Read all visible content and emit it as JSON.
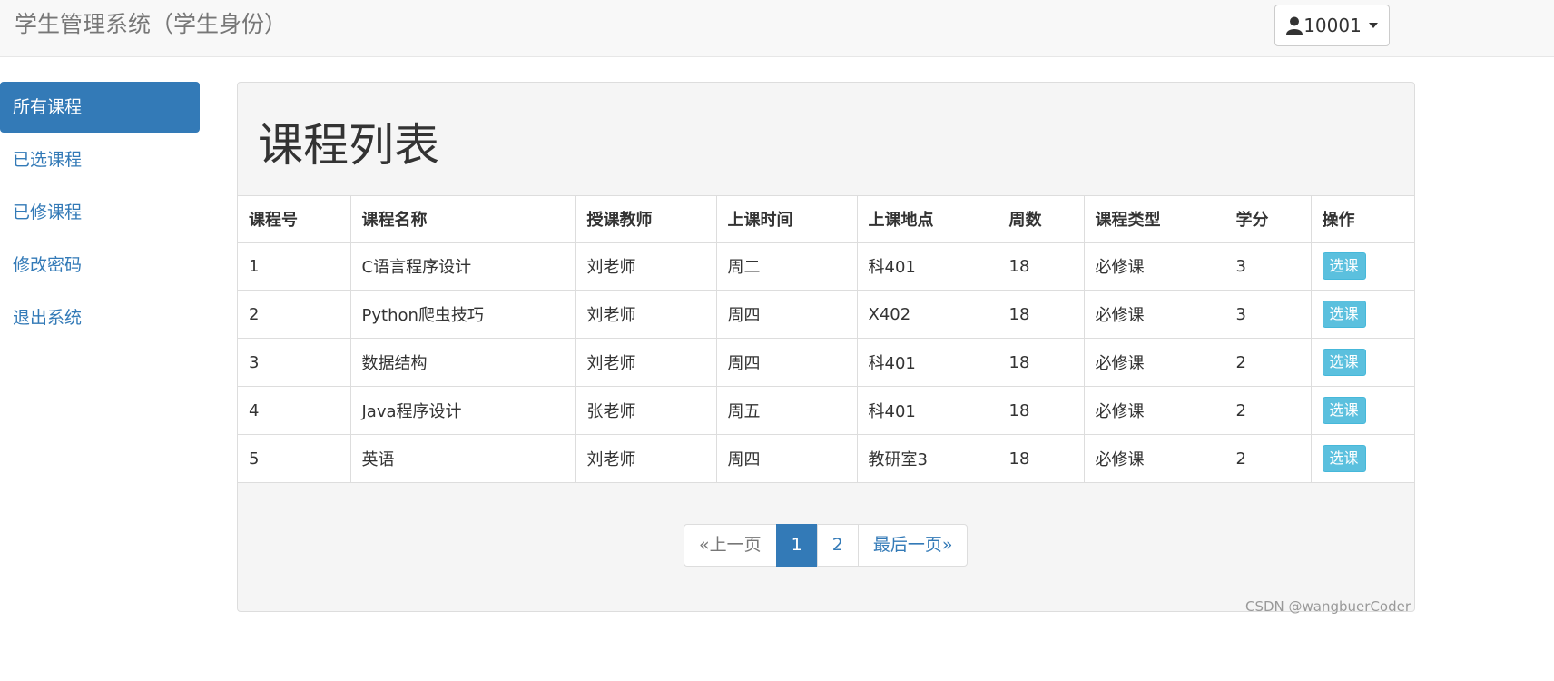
{
  "navbar": {
    "brand": "学生管理系统（学生身份）",
    "user": {
      "icon": "user-icon",
      "label": "10001"
    }
  },
  "sidebar": {
    "items": [
      {
        "label": "所有课程",
        "active": true
      },
      {
        "label": "已选课程",
        "active": false
      },
      {
        "label": "已修课程",
        "active": false
      },
      {
        "label": "修改密码",
        "active": false
      },
      {
        "label": "退出系统",
        "active": false
      }
    ]
  },
  "main": {
    "title": "课程列表",
    "table": {
      "headers": [
        "课程号",
        "课程名称",
        "授课教师",
        "上课时间",
        "上课地点",
        "周数",
        "课程类型",
        "学分",
        "操作"
      ],
      "rows": [
        [
          "1",
          "C语言程序设计",
          "刘老师",
          "周二",
          "科401",
          "18",
          "必修课",
          "3"
        ],
        [
          "2",
          "Python爬虫技巧",
          "刘老师",
          "周四",
          "X402",
          "18",
          "必修课",
          "3"
        ],
        [
          "3",
          "数据结构",
          "刘老师",
          "周四",
          "科401",
          "18",
          "必修课",
          "2"
        ],
        [
          "4",
          "Java程序设计",
          "张老师",
          "周五",
          "科401",
          "18",
          "必修课",
          "2"
        ],
        [
          "5",
          "英语",
          "刘老师",
          "周四",
          "教研室3",
          "18",
          "必修课",
          "2"
        ]
      ],
      "action_label": "选课"
    },
    "pagination": {
      "prev": "«上一页",
      "pages": [
        "1",
        "2"
      ],
      "current": "1",
      "last": "最后一页»"
    }
  },
  "watermark": "CSDN @wangbuerCoder",
  "colors": {
    "primary": "#337ab7",
    "info": "#5bc0de",
    "navbar_bg": "#f8f8f8",
    "panel_bg": "#f5f5f5"
  }
}
